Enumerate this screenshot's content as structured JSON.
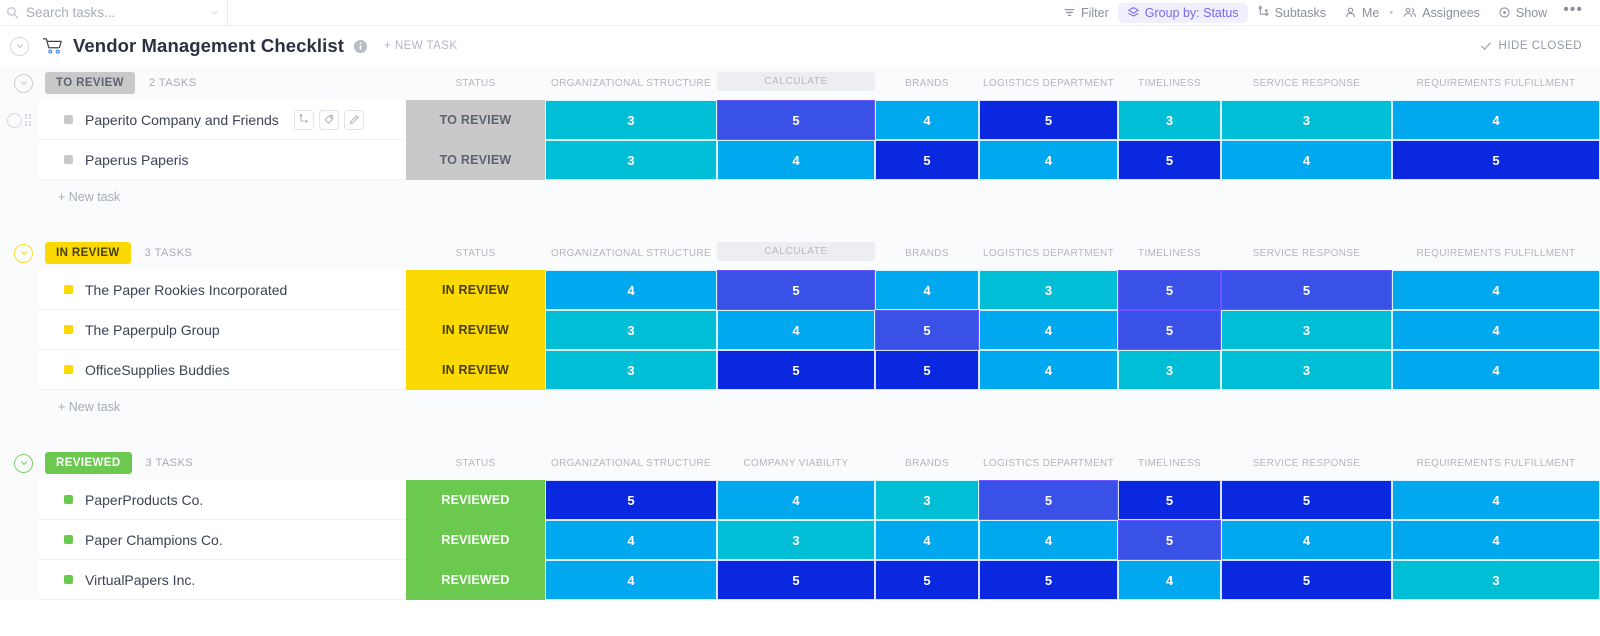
{
  "topbar": {
    "search": {
      "placeholder": "Search tasks...",
      "value": ""
    },
    "items": [
      {
        "label": "Filter",
        "icon": "filter-icon",
        "active": false
      },
      {
        "label": "Group by: Status",
        "icon": "layers-icon",
        "active": true
      },
      {
        "label": "Subtasks",
        "icon": "subtask-icon",
        "active": false
      },
      {
        "label": "Me",
        "icon": "person-icon",
        "active": false
      },
      {
        "label": "Assignees",
        "icon": "people-icon",
        "active": false
      },
      {
        "label": "Show",
        "icon": "eye-icon",
        "active": false
      }
    ],
    "more_label": "•••"
  },
  "header": {
    "title": "Vendor Management Checklist",
    "list_icon": "shopping-cart-icon",
    "info_icon": "info-icon",
    "new_task_label": "+ NEW TASK",
    "hide_closed_label": "HIDE CLOSED",
    "hide_closed_icon": "check-icon"
  },
  "columns": [
    {
      "key": "status",
      "label": "STATUS"
    },
    {
      "key": "org",
      "label": "ORGANIZATIONAL STRUCTURE"
    },
    {
      "key": "viability",
      "label": "COMPANY VIABILITY"
    },
    {
      "key": "brands",
      "label": "BRANDS"
    },
    {
      "key": "logistics",
      "label": "LOGISTICS DEPARTMENT"
    },
    {
      "key": "timeliness",
      "label": "TIMELINESS"
    },
    {
      "key": "service",
      "label": "SERVICE RESPONSE"
    },
    {
      "key": "requirements",
      "label": "REQUIREMENTS FULFILLMENT"
    }
  ],
  "colors": {
    "to_review": "#c9c9c9",
    "in_review": "#fbd902",
    "reviewed": "#6bc950",
    "rating_3": "#00bed6",
    "rating_4": "#00a8f0",
    "rating_5": "#0a28e0",
    "rating_5_selected": "#3a51e8",
    "accent": "#7b68ee"
  },
  "rating_scale": {
    "3": "rating_3",
    "4": "rating_4",
    "5": "rating_5"
  },
  "groups": [
    {
      "status": "TO REVIEW",
      "status_key": "to_review",
      "task_count": "2 TASKS",
      "new_task_label": "+ New task",
      "calculate_label": "CALCULATE",
      "tasks": [
        {
          "name": "Paperito Company and Friends",
          "status": "TO REVIEW",
          "hovered": true,
          "icons": [
            "subtask-icon",
            "tag-icon",
            "edit-icon"
          ],
          "ratings": {
            "org": 3,
            "viability": 5,
            "brands": 4,
            "logistics": 5,
            "timeliness": 3,
            "service": 3,
            "requirements": 4
          },
          "selected": [
            "viability"
          ]
        },
        {
          "name": "Paperus Paperis",
          "status": "TO REVIEW",
          "hovered": false,
          "icons": [],
          "ratings": {
            "org": 3,
            "viability": 4,
            "brands": 5,
            "logistics": 4,
            "timeliness": 5,
            "service": 4,
            "requirements": 5
          },
          "selected": []
        }
      ]
    },
    {
      "status": "IN REVIEW",
      "status_key": "in_review",
      "task_count": "3 TASKS",
      "new_task_label": "+ New task",
      "calculate_label": "CALCULATE",
      "tasks": [
        {
          "name": "The Paper Rookies Incorporated",
          "status": "IN REVIEW",
          "hovered": false,
          "icons": [],
          "ratings": {
            "org": 4,
            "viability": 5,
            "brands": 4,
            "logistics": 3,
            "timeliness": 5,
            "service": 5,
            "requirements": 4
          },
          "selected": [
            "viability",
            "timeliness",
            "service"
          ]
        },
        {
          "name": "The Paperpulp Group",
          "status": "IN REVIEW",
          "hovered": false,
          "icons": [],
          "ratings": {
            "org": 3,
            "viability": 4,
            "brands": 5,
            "logistics": 4,
            "timeliness": 5,
            "service": 3,
            "requirements": 4
          },
          "selected": [
            "brands",
            "timeliness"
          ]
        },
        {
          "name": "OfficeSupplies Buddies",
          "status": "IN REVIEW",
          "hovered": false,
          "icons": [],
          "ratings": {
            "org": 3,
            "viability": 5,
            "brands": 5,
            "logistics": 4,
            "timeliness": 3,
            "service": 3,
            "requirements": 4
          },
          "selected": []
        }
      ]
    },
    {
      "status": "REVIEWED",
      "status_key": "reviewed",
      "task_count": "3 TASKS",
      "new_task_label": "",
      "calculate_label": "",
      "tasks": [
        {
          "name": "PaperProducts Co.",
          "status": "REVIEWED",
          "hovered": false,
          "icons": [],
          "ratings": {
            "org": 5,
            "viability": 4,
            "brands": 3,
            "logistics": 5,
            "timeliness": 5,
            "service": 5,
            "requirements": 4
          },
          "selected": [
            "logistics"
          ]
        },
        {
          "name": "Paper Champions Co.",
          "status": "REVIEWED",
          "hovered": false,
          "icons": [],
          "ratings": {
            "org": 4,
            "viability": 3,
            "brands": 4,
            "logistics": 4,
            "timeliness": 5,
            "service": 4,
            "requirements": 4
          },
          "selected": [
            "timeliness"
          ]
        },
        {
          "name": "VirtualPapers Inc.",
          "status": "REVIEWED",
          "hovered": false,
          "icons": [],
          "ratings": {
            "org": 4,
            "viability": 5,
            "brands": 5,
            "logistics": 5,
            "timeliness": 4,
            "service": 5,
            "requirements": 3
          },
          "selected": []
        }
      ]
    }
  ]
}
